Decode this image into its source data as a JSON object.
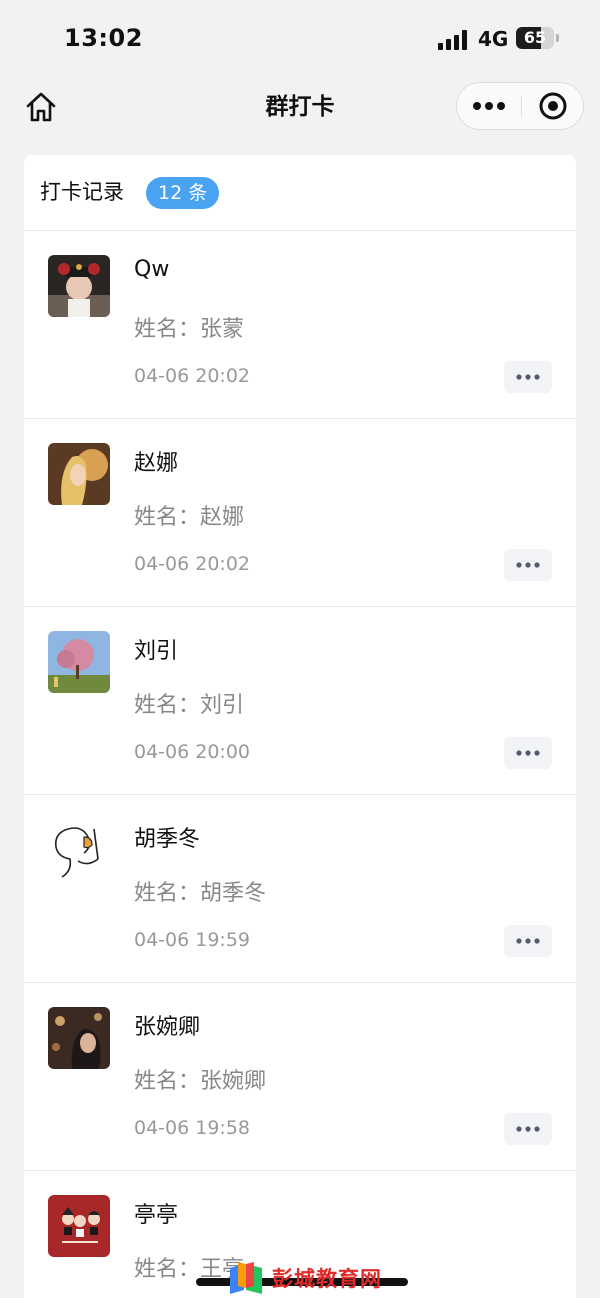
{
  "status_bar": {
    "time": "13:02",
    "network": "4G",
    "battery": "65",
    "battery_level": 0.65
  },
  "nav": {
    "title": "群打卡",
    "home_icon": "home-icon",
    "more_icon": "more-horizontal-icon",
    "close_icon": "target-circle-icon"
  },
  "card": {
    "title": "打卡记录",
    "count": "12 条",
    "accent_color": "#4aa3f0"
  },
  "records": [
    {
      "nickname": "Qw",
      "field_label": "姓名：",
      "field_value": "张蒙",
      "time": "04-06 20:02",
      "avatar": "avatar-photo-icon"
    },
    {
      "nickname": "赵娜",
      "field_label": "姓名：",
      "field_value": "赵娜",
      "time": "04-06 20:02",
      "avatar": "avatar-photo-icon"
    },
    {
      "nickname": "刘引",
      "field_label": "姓名：",
      "field_value": "刘引",
      "time": "04-06 20:00",
      "avatar": "avatar-landscape-icon"
    },
    {
      "nickname": "胡季冬",
      "field_label": "姓名：",
      "field_value": "胡季冬",
      "time": "04-06 19:59",
      "avatar": "avatar-sketch-icon"
    },
    {
      "nickname": "张婉卿",
      "field_label": "姓名：",
      "field_value": "张婉卿",
      "time": "04-06 19:58",
      "avatar": "avatar-photo-icon"
    },
    {
      "nickname": "亭亭",
      "field_label": "姓名：",
      "field_value": "王亭",
      "time": "",
      "avatar": "avatar-illustration-icon"
    }
  ],
  "watermark": {
    "text": "彭城教育网"
  }
}
